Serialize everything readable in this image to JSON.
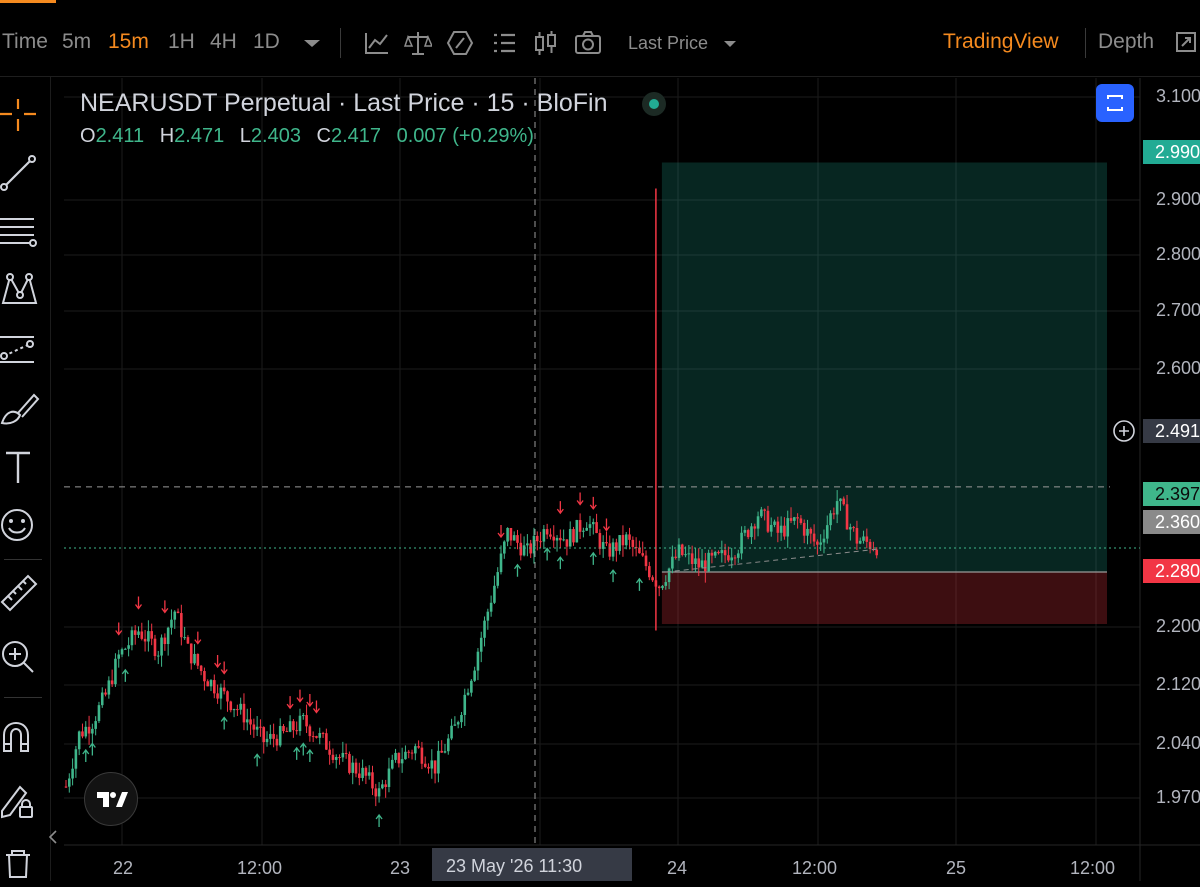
{
  "toolbar": {
    "intervals": [
      "Time",
      "5m",
      "15m",
      "1H",
      "4H",
      "1D"
    ],
    "active_interval": "15m",
    "price_source": "Last Price",
    "view_tabs": [
      "TradingView",
      "Depth"
    ],
    "active_view": "TradingView",
    "icons": [
      "indicators-icon",
      "compare-icon",
      "templates-icon",
      "settings-list-icon",
      "candle-style-icon",
      "screenshot-icon"
    ]
  },
  "sidebar": {
    "tools": [
      "crosshair-icon",
      "trend-line-icon",
      "fib-icon",
      "pattern-icon",
      "forecast-icon",
      "brush-icon",
      "text-icon",
      "emoji-icon",
      "ruler-icon",
      "zoom-icon",
      "magnet-icon",
      "lock-drawings-icon"
    ]
  },
  "legend": {
    "title": "NEARUSDT Perpetual · Last Price · 15 · BloFin",
    "o_label": "O",
    "o": "2.411",
    "h_label": "H",
    "h": "2.471",
    "l_label": "L",
    "l": "2.403",
    "c_label": "C",
    "c": "2.417",
    "change": "0.007 (+0.29%)"
  },
  "price_axis": {
    "labels": [
      "3.100",
      "2.900",
      "2.800",
      "2.700",
      "2.600",
      "2.200",
      "2.120",
      "2.040",
      "1.970"
    ],
    "tags": {
      "take_profit": "2.990",
      "crosshair": "2.491",
      "last_price": "2.397",
      "entry": "2.360",
      "stop_loss": "2.280"
    }
  },
  "time_axis": {
    "labels": [
      "22",
      "12:00",
      "23",
      "24",
      "12:00",
      "25",
      "12:00"
    ],
    "crosshair_label": "23 May '26  11:30"
  },
  "chart_data": {
    "type": "candlestick",
    "symbol": "NEARUSDT Perpetual",
    "interval": "15",
    "exchange": "BloFin",
    "ylim": [
      1.94,
      3.12
    ],
    "long_position": {
      "entry": 2.36,
      "take_profit": 2.99,
      "stop_loss": 2.28
    },
    "crosshair_price": 2.491,
    "last_price": 2.397,
    "close_path": [
      {
        "t": 0,
        "p": 2.03
      },
      {
        "t": 4,
        "p": 2.11
      },
      {
        "t": 8,
        "p": 2.13
      },
      {
        "t": 12,
        "p": 2.17
      },
      {
        "t": 16,
        "p": 2.23
      },
      {
        "t": 22,
        "p": 2.27
      },
      {
        "t": 28,
        "p": 2.24
      },
      {
        "t": 33,
        "p": 2.3
      },
      {
        "t": 37,
        "p": 2.24
      },
      {
        "t": 42,
        "p": 2.2
      },
      {
        "t": 48,
        "p": 2.17
      },
      {
        "t": 54,
        "p": 2.14
      },
      {
        "t": 60,
        "p": 2.1
      },
      {
        "t": 66,
        "p": 2.11
      },
      {
        "t": 72,
        "p": 2.13
      },
      {
        "t": 78,
        "p": 2.1
      },
      {
        "t": 84,
        "p": 2.07
      },
      {
        "t": 90,
        "p": 2.05
      },
      {
        "t": 95,
        "p": 2.02
      },
      {
        "t": 100,
        "p": 2.07
      },
      {
        "t": 106,
        "p": 2.09
      },
      {
        "t": 112,
        "p": 2.06
      },
      {
        "t": 118,
        "p": 2.12
      },
      {
        "t": 124,
        "p": 2.22
      },
      {
        "t": 130,
        "p": 2.34
      },
      {
        "t": 134,
        "p": 2.42
      },
      {
        "t": 140,
        "p": 2.39
      },
      {
        "t": 146,
        "p": 2.43
      },
      {
        "t": 152,
        "p": 2.41
      },
      {
        "t": 158,
        "p": 2.44
      },
      {
        "t": 164,
        "p": 2.39
      },
      {
        "t": 170,
        "p": 2.41
      },
      {
        "t": 176,
        "p": 2.37
      },
      {
        "t": 180,
        "p": 2.34
      },
      {
        "t": 186,
        "p": 2.39
      },
      {
        "t": 192,
        "p": 2.37
      },
      {
        "t": 198,
        "p": 2.38
      },
      {
        "t": 204,
        "p": 2.4
      },
      {
        "t": 210,
        "p": 2.45
      },
      {
        "t": 216,
        "p": 2.42
      },
      {
        "t": 222,
        "p": 2.44
      },
      {
        "t": 228,
        "p": 2.4
      },
      {
        "t": 234,
        "p": 2.47
      },
      {
        "t": 240,
        "p": 2.41
      },
      {
        "t": 246,
        "p": 2.4
      }
    ],
    "signals_up": [
      6,
      8,
      18,
      48,
      58,
      70,
      72,
      74,
      95,
      137,
      146,
      150,
      160,
      166,
      174
    ],
    "signals_down": [
      16,
      22,
      30,
      40,
      46,
      48,
      68,
      71,
      74,
      76,
      132,
      150,
      156,
      160,
      164
    ]
  }
}
